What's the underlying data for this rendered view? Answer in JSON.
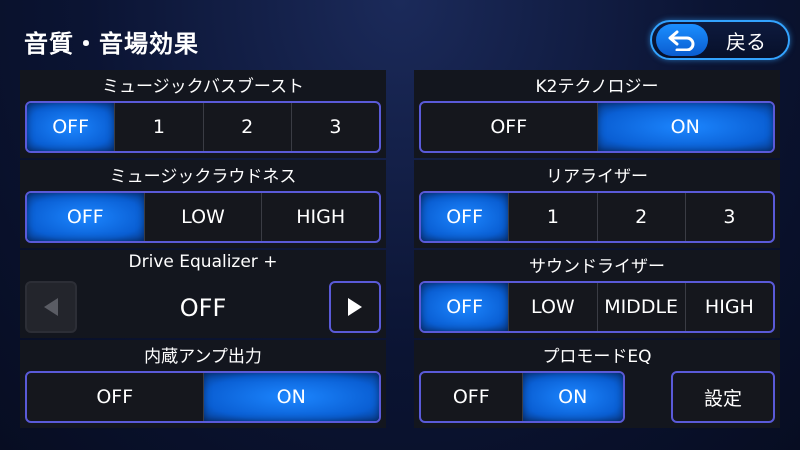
{
  "header": {
    "title": "音質・音場効果",
    "back_label": "戻る"
  },
  "music_bass_boost": {
    "label": "ミュージックバスブースト",
    "options": [
      "OFF",
      "1",
      "2",
      "3"
    ],
    "selected": 0
  },
  "music_loudness": {
    "label": "ミュージックラウドネス",
    "options": [
      "OFF",
      "LOW",
      "HIGH"
    ],
    "selected": 0
  },
  "drive_equalizer": {
    "label": "Drive Equalizer +",
    "value": "OFF"
  },
  "internal_amp": {
    "label": "内蔵アンプ出力",
    "options": [
      "OFF",
      "ON"
    ],
    "selected": 1
  },
  "k2_technology": {
    "label": "K2テクノロジー",
    "options": [
      "OFF",
      "ON"
    ],
    "selected": 1
  },
  "rear_riser": {
    "label": "リアライザー",
    "options": [
      "OFF",
      "1",
      "2",
      "3"
    ],
    "selected": 0
  },
  "sound_riser": {
    "label": "サウンドライザー",
    "options": [
      "OFF",
      "LOW",
      "MIDDLE",
      "HIGH"
    ],
    "selected": 0
  },
  "pro_mode_eq": {
    "label": "プロモードEQ",
    "options": [
      "OFF",
      "ON"
    ],
    "selected": 1,
    "settings_label": "設定"
  },
  "colors": {
    "accent": "#1c86ff",
    "border": "#5a5ad8",
    "panel": "#13161e"
  }
}
